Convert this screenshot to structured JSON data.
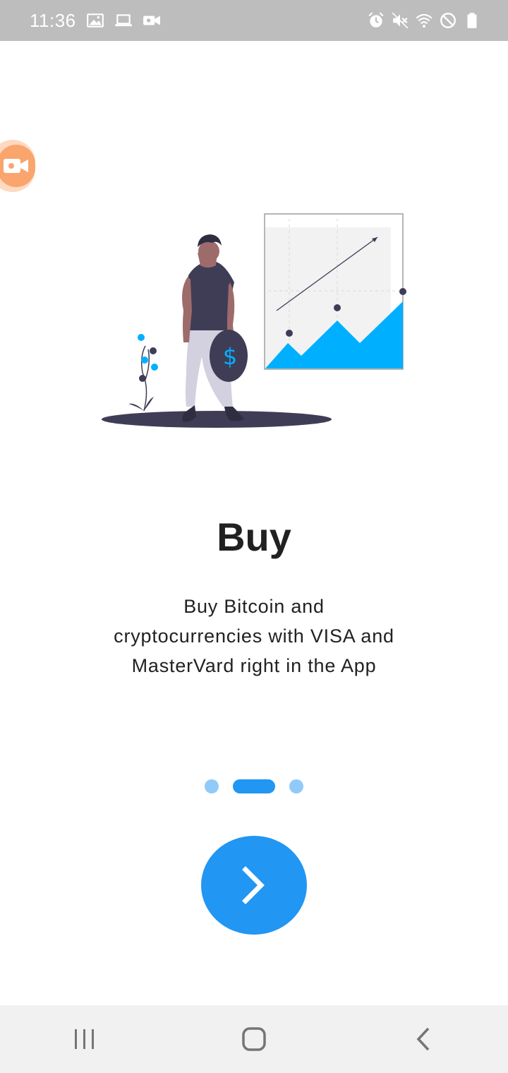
{
  "status_bar": {
    "time": "11:36",
    "left_icons": [
      "gallery-icon",
      "laptop-icon",
      "video-camera-icon"
    ],
    "right_icons": [
      "alarm-icon",
      "mute-icon",
      "wifi-icon",
      "do-not-disturb-icon",
      "battery-icon"
    ]
  },
  "onboarding": {
    "title": "Buy",
    "description": "Buy Bitcoin and cryptocurrencies with VISA and MasterVard right in the App",
    "current_page": 2,
    "total_pages": 3
  },
  "next_button": {
    "icon": "chevron-right-icon"
  },
  "nav_bar": {
    "buttons": [
      "recent-apps-icon",
      "home-icon",
      "back-icon"
    ]
  },
  "colors": {
    "accent": "#2196f3",
    "dot_inactive": "#90caf9",
    "chart_fill": "#00b0ff",
    "dark_figure": "#3f3d56",
    "recorder": "#f9a56d"
  }
}
